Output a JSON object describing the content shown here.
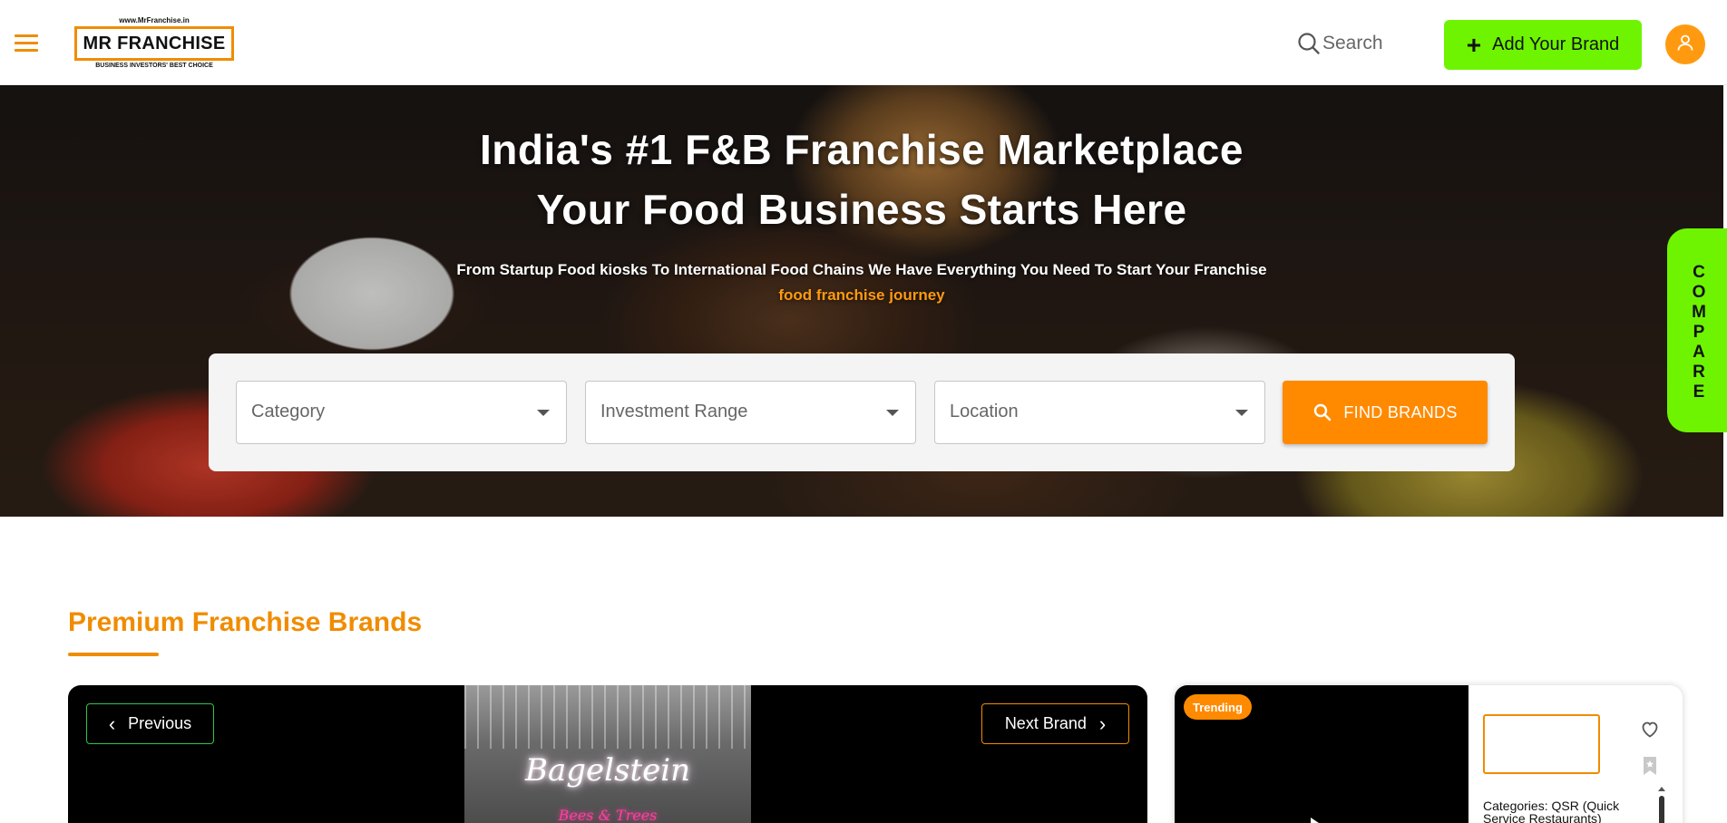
{
  "header": {
    "logo": {
      "url_text": "www.MrFranchise.in",
      "name": "MR FRANCHISE",
      "tagline": "BUSINESS INVESTORS' BEST CHOICE"
    },
    "search_label": "Search",
    "add_brand_label": "Add Your Brand",
    "icons": {
      "menu": "hamburger-menu-icon",
      "search": "search-icon",
      "add": "plus-icon",
      "user": "user-icon"
    }
  },
  "hero": {
    "title_line1": "India's #1 F&B Franchise Marketplace",
    "title_line2": "Your Food Business Starts Here",
    "subtitle": "From Startup Food kiosks To International Food Chains We Have Everything You Need To Start Your Franchise",
    "accent_text": "food franchise journey",
    "filters": {
      "category_label": "Category",
      "investment_label": "Investment Range",
      "location_label": "Location",
      "find_label": "FIND BRANDS"
    }
  },
  "compare_tab": {
    "letters": [
      "C",
      "O",
      "M",
      "P",
      "A",
      "R",
      "E"
    ]
  },
  "premium": {
    "section_title": "Premium Franchise Brands",
    "prev_label": "Previous",
    "next_label": "Next Brand",
    "video_sign": "Bagelstein",
    "video_sign_sub": "Bees & Trees",
    "card": {
      "badge": "Trending",
      "category_text": "Categories: QSR (Quick Service Restaurants)"
    }
  },
  "colors": {
    "accent_orange": "#f08c00",
    "button_orange": "#ff8a00",
    "brand_green": "#6ef400",
    "prev_border_green": "#2ec64a",
    "user_orange": "#ff9a10"
  }
}
